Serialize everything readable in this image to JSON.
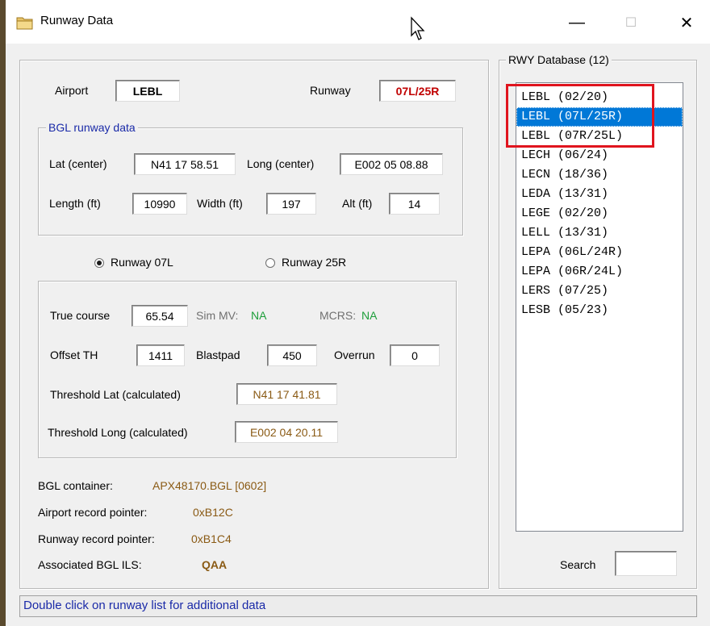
{
  "window": {
    "title": "Runway Data",
    "minimize_glyph": "—",
    "maximize_glyph": "☐",
    "close_glyph": "✕"
  },
  "header": {
    "airport_label": "Airport",
    "airport_value": "LEBL",
    "runway_label": "Runway",
    "runway_value": "07L/25R",
    "runway_value_color": "#c00000"
  },
  "bgl": {
    "legend": "BGL runway data",
    "legend_color": "#1a2aa8",
    "lat_label": "Lat (center)",
    "lat_value": "N41 17 58.51",
    "long_label": "Long (center)",
    "long_value": "E002 05 08.88",
    "length_label": "Length (ft)",
    "length_value": "10990",
    "width_label": "Width (ft)",
    "width_value": "197",
    "alt_label": "Alt (ft)",
    "alt_value": "14"
  },
  "runway_radios": {
    "option_a": "Runway 07L",
    "option_a_selected": true,
    "option_b": "Runway 25R",
    "option_b_selected": false
  },
  "detail": {
    "true_course_label": "True course",
    "true_course_value": "65.54",
    "sim_mv_label": "Sim MV:",
    "sim_mv_value": "NA",
    "mcrs_label": "MCRS:",
    "mcrs_value": "NA",
    "offset_th_label": "Offset TH",
    "offset_th_value": "1411",
    "blastpad_label": "Blastpad",
    "blastpad_value": "450",
    "overrun_label": "Overrun",
    "overrun_value": "0",
    "threshold_lat_label": "Threshold Lat (calculated)",
    "threshold_lat_value": "N41 17 41.81",
    "threshold_long_label": "Threshold Long (calculated)",
    "threshold_long_value": "E002 04 20.11"
  },
  "info": {
    "container_label": "BGL container:",
    "container_value": "APX48170.BGL [0602]",
    "airport_ptr_label": "Airport record pointer:",
    "airport_ptr_value": "0xB12C",
    "runway_ptr_label": "Runway record pointer:",
    "runway_ptr_value": "0xB1C4",
    "ils_label": "Associated BGL ILS:",
    "ils_value": "QAA"
  },
  "database": {
    "legend": "RWY Database (12)",
    "items": [
      "LEBL (02/20)",
      "LEBL (07L/25R)",
      "LEBL (07R/25L)",
      "LECH (06/24)",
      "LECN (18/36)",
      "LEDA (13/31)",
      "LEGE (02/20)",
      "LELL (13/31)",
      "LEPA (06L/24R)",
      "LEPA (06R/24L)",
      "LERS (07/25)",
      "LESB (05/23)"
    ],
    "selected_index": 1,
    "search_label": "Search",
    "search_value": ""
  },
  "status": {
    "text": "Double click on runway list for additional data"
  }
}
